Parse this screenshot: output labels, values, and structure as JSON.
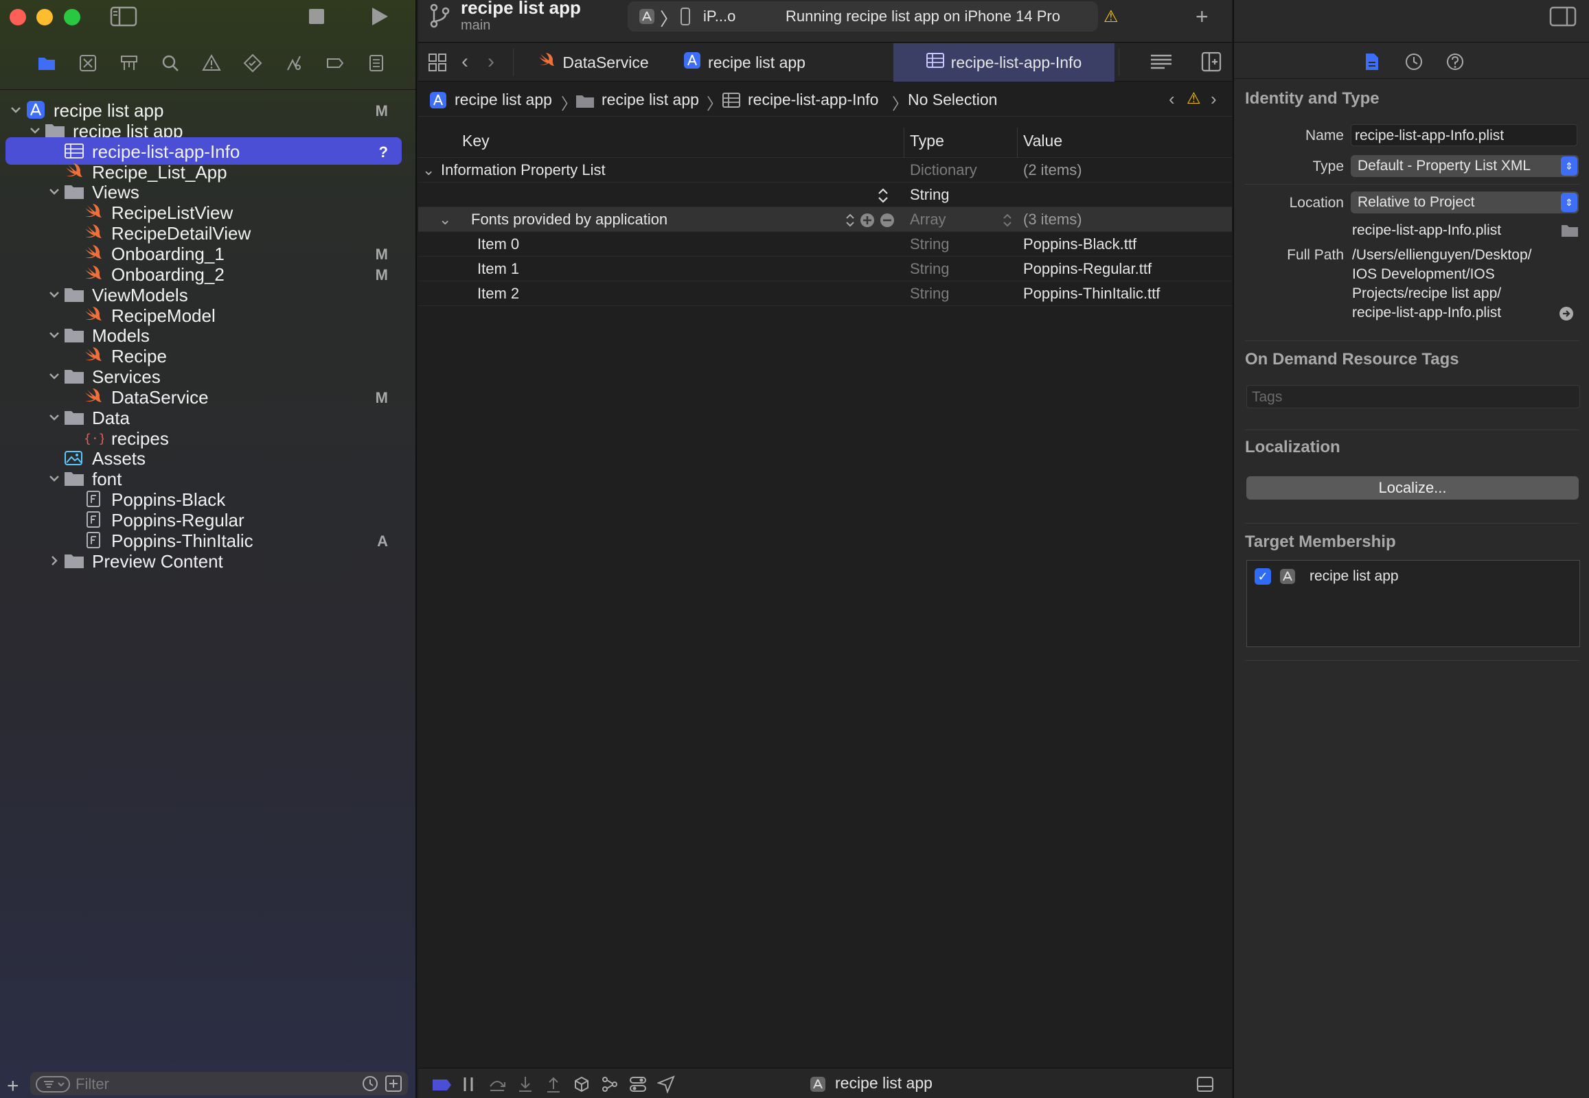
{
  "window": {
    "project_name": "recipe list app",
    "branch": "main",
    "device_short": "iP...o",
    "status": "Running recipe list app on iPhone 14 Pro"
  },
  "navigator": {
    "filter_placeholder": "Filter",
    "items": [
      {
        "label": "recipe list app",
        "badge": "M",
        "kind": "project",
        "level": 0,
        "expanded": true
      },
      {
        "label": "recipe list app",
        "badge": "",
        "kind": "folder",
        "level": 1,
        "expanded": true
      },
      {
        "label": "recipe-list-app-Info",
        "badge": "?",
        "kind": "plist",
        "level": 2,
        "selected": true
      },
      {
        "label": "Recipe_List_App",
        "badge": "",
        "kind": "swift",
        "level": 2
      },
      {
        "label": "Views",
        "badge": "",
        "kind": "folder",
        "level": 2,
        "expanded": true
      },
      {
        "label": "RecipeListView",
        "badge": "",
        "kind": "swift",
        "level": 3
      },
      {
        "label": "RecipeDetailView",
        "badge": "",
        "kind": "swift",
        "level": 3
      },
      {
        "label": "Onboarding_1",
        "badge": "M",
        "kind": "swift",
        "level": 3
      },
      {
        "label": "Onboarding_2",
        "badge": "M",
        "kind": "swift",
        "level": 3
      },
      {
        "label": "ViewModels",
        "badge": "",
        "kind": "folder",
        "level": 2,
        "expanded": true
      },
      {
        "label": "RecipeModel",
        "badge": "",
        "kind": "swift",
        "level": 3
      },
      {
        "label": "Models",
        "badge": "",
        "kind": "folder",
        "level": 2,
        "expanded": true
      },
      {
        "label": "Recipe",
        "badge": "",
        "kind": "swift",
        "level": 3
      },
      {
        "label": "Services",
        "badge": "",
        "kind": "folder",
        "level": 2,
        "expanded": true
      },
      {
        "label": "DataService",
        "badge": "M",
        "kind": "swift",
        "level": 3
      },
      {
        "label": "Data",
        "badge": "",
        "kind": "folder",
        "level": 2,
        "expanded": true
      },
      {
        "label": "recipes",
        "badge": "",
        "kind": "json",
        "level": 3
      },
      {
        "label": "Assets",
        "badge": "",
        "kind": "assets",
        "level": 2
      },
      {
        "label": "font",
        "badge": "",
        "kind": "folder",
        "level": 2,
        "expanded": true
      },
      {
        "label": "Poppins-Black",
        "badge": "",
        "kind": "font",
        "level": 3
      },
      {
        "label": "Poppins-Regular",
        "badge": "",
        "kind": "font",
        "level": 3
      },
      {
        "label": "Poppins-ThinItalic",
        "badge": "A",
        "kind": "font",
        "level": 3
      },
      {
        "label": "Preview Content",
        "badge": "",
        "kind": "folder",
        "level": 2,
        "expanded": false
      }
    ]
  },
  "tabs": [
    {
      "label": "DataService",
      "icon": "swift-icon"
    },
    {
      "label": "recipe list app",
      "icon": "app-icon"
    },
    {
      "label": "recipe-list-app-Info",
      "icon": "plist-icon",
      "active": true
    }
  ],
  "jumpbar": {
    "project": "recipe list app",
    "group": "recipe list app",
    "file": "recipe-list-app-Info",
    "selection": "No Selection"
  },
  "plist": {
    "headers": {
      "key": "Key",
      "type": "Type",
      "value": "Value"
    },
    "rows": [
      {
        "key": "Information Property List",
        "type": "Dictionary",
        "value": "(2 items)"
      },
      {
        "key": "",
        "type": "String",
        "value": ""
      },
      {
        "key": "Fonts provided by application",
        "type": "Array",
        "value": "(3 items)"
      },
      {
        "key": "Item 0",
        "type": "String",
        "value": "Poppins-Black.ttf"
      },
      {
        "key": "Item 1",
        "type": "String",
        "value": "Poppins-Regular.ttf"
      },
      {
        "key": "Item 2",
        "type": "String",
        "value": "Poppins-ThinItalic.ttf"
      }
    ]
  },
  "debugbar": {
    "scheme": "recipe list app"
  },
  "inspector": {
    "identity_title": "Identity and Type",
    "name_label": "Name",
    "name_value": "recipe-list-app-Info.plist",
    "type_label": "Type",
    "type_value": "Default - Property List XML",
    "location_label": "Location",
    "location_value": "Relative to Project",
    "location_file": "recipe-list-app-Info.plist",
    "fullpath_label": "Full Path",
    "fullpath_lines": [
      "/Users/ellienguyen/Desktop/",
      "IOS Development/IOS",
      "Projects/recipe list app/",
      "recipe-list-app-Info.plist"
    ],
    "odr_title": "On Demand Resource Tags",
    "tags_placeholder": "Tags",
    "localization_title": "Localization",
    "localize_button": "Localize...",
    "target_title": "Target Membership",
    "target_name": "recipe list app"
  },
  "colors": {
    "accent": "#4a4fd6",
    "swift": "#f0703a",
    "warning": "#f5c400",
    "folder": "#a0a0a8"
  }
}
